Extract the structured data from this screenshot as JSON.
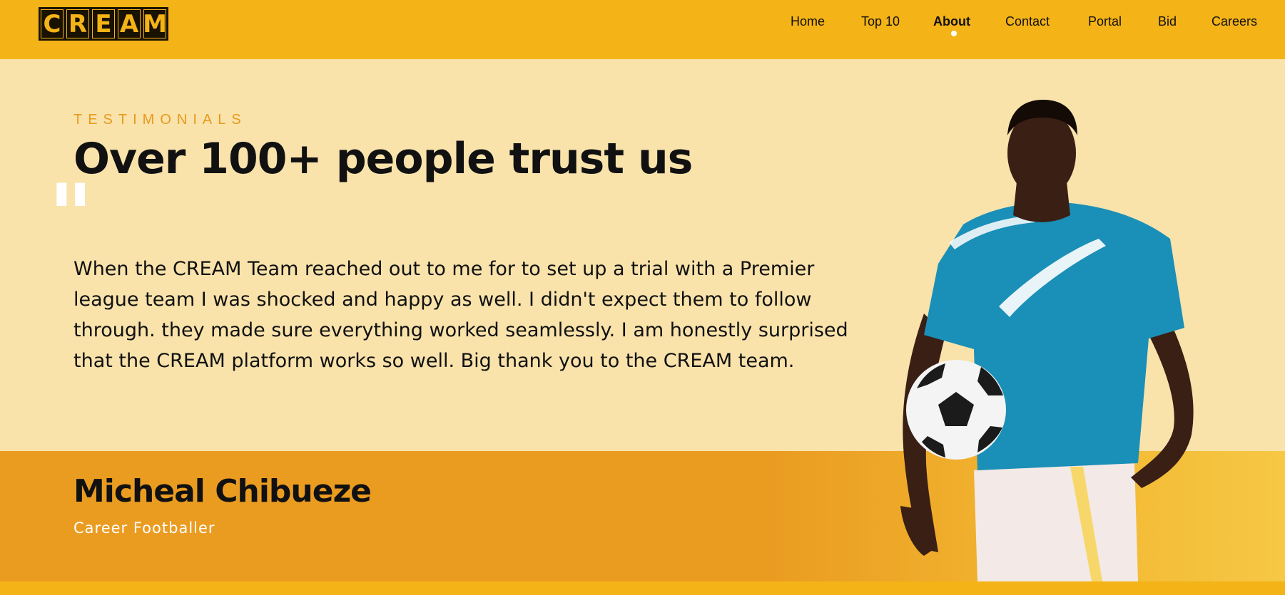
{
  "brand": {
    "logo_letters": [
      "C",
      "R",
      "E",
      "A",
      "M"
    ],
    "colors": {
      "primary": "#f4b316",
      "dark": "#1a1200",
      "accent": "#e89a1c",
      "background": "#f9e3ab"
    }
  },
  "nav": {
    "items": [
      {
        "label": "Home"
      },
      {
        "label": "Top 10"
      },
      {
        "label": "About",
        "active": true
      },
      {
        "label": "Contact"
      },
      {
        "label": "Portal"
      },
      {
        "label": "Bid"
      },
      {
        "label": "Careers"
      }
    ]
  },
  "testimonials": {
    "eyebrow": "TESTIMONIALS",
    "headline_pre": "Over ",
    "headline_bold": "100+ people",
    "headline_post": " trust us",
    "quote_mark": "\"",
    "quote": "When the CREAM Team reached out to me for to set up a trial with a Premier league team I was shocked and happy as well. I didn't expect them to follow through. they made sure everything worked seamlessly. I am honestly surprised that the CREAM platform works so well. Big thank you to the CREAM team.",
    "author_name": "Micheal Chibueze",
    "author_role": "Career Footballer"
  },
  "images": {
    "player": "footballer-holding-ball-photo"
  }
}
